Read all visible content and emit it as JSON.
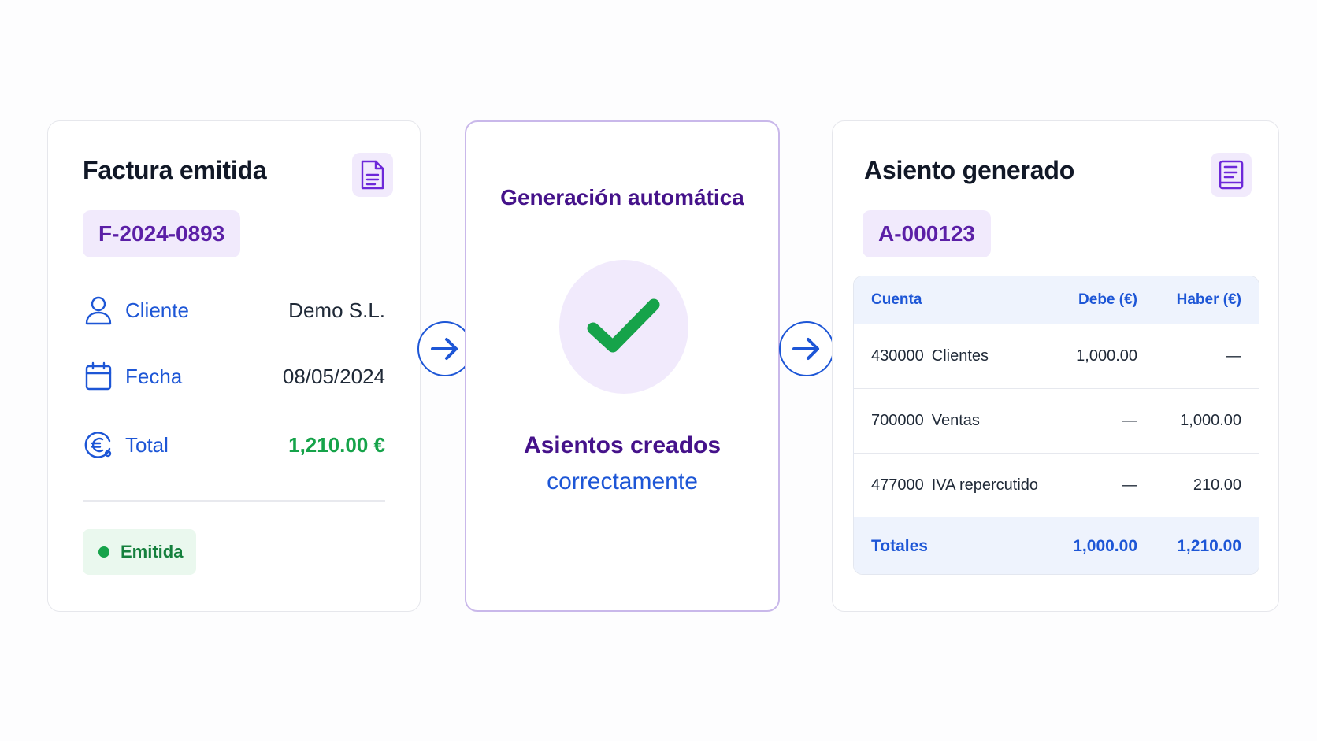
{
  "invoice_card": {
    "title": "Factura emitida",
    "icon": "document-icon",
    "number": "F-2024-0893",
    "rows": [
      {
        "icon": "user-icon",
        "label": "Cliente",
        "value": "Demo S.L."
      },
      {
        "icon": "calendar-icon",
        "label": "Fecha",
        "value": "08/05/2024"
      },
      {
        "icon": "euro-icon",
        "label": "Total",
        "value": "1,210.00 €"
      }
    ],
    "status": "Emitida"
  },
  "auto_card": {
    "title": "Generación automática",
    "icon": "check-icon",
    "line1": "Asientos creados",
    "line2": "correctamente"
  },
  "entry_card": {
    "title": "Asiento generado",
    "icon": "ledger-book-icon",
    "number": "A-000123",
    "table": {
      "headers": {
        "account": "Cuenta",
        "debe": "Debe (€)",
        "haber": "Haber (€)"
      },
      "rows": [
        {
          "code": "430000",
          "name": "Clientes",
          "debe": "1,000.00",
          "haber": "—"
        },
        {
          "code": "700000",
          "name": "Ventas",
          "debe": "—",
          "haber": "1,000.00"
        },
        {
          "code": "477000",
          "name": "IVA repercutido",
          "debe": "—",
          "haber": "210.00"
        }
      ],
      "totals": {
        "label": "Totales",
        "debe": "1,000.00",
        "haber": "1,210.00"
      }
    }
  },
  "colors": {
    "accent_blue": "#1d56d6",
    "accent_purple": "#45128a",
    "success_green": "#16a34a",
    "pill_bg": "#f1eafc"
  }
}
